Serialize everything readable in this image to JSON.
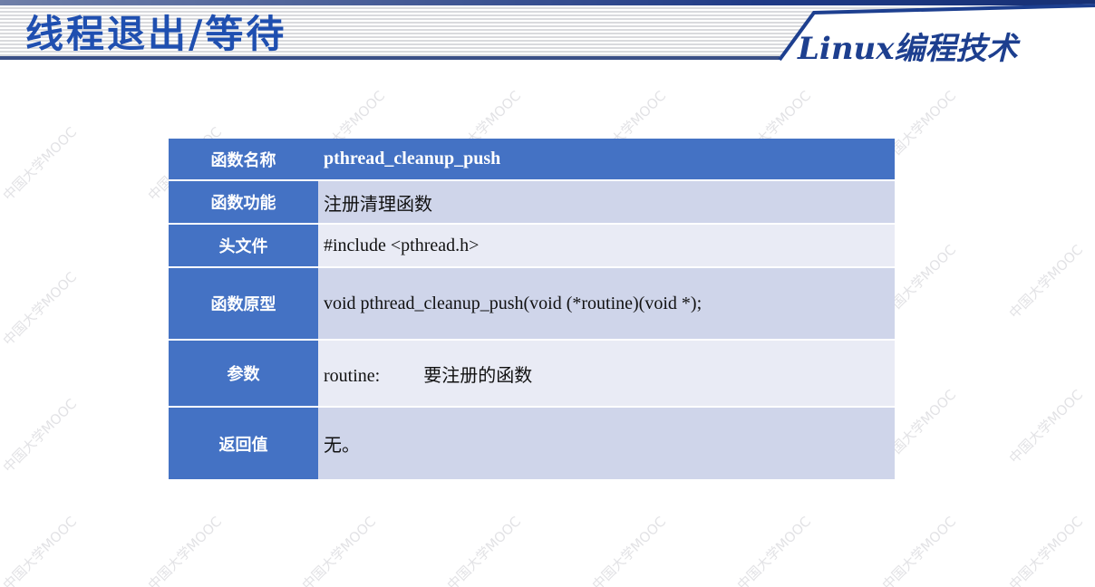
{
  "header": {
    "title": "线程退出/等待",
    "brand": "Linux编程技术"
  },
  "watermark": "中国大学MOOC",
  "table": {
    "rows": [
      {
        "label": "函数名称",
        "value": "pthread_cleanup_push"
      },
      {
        "label": "函数功能",
        "value": "注册清理函数"
      },
      {
        "label": "头文件",
        "value": "#include <pthread.h>"
      },
      {
        "label": "函数原型",
        "value": "void pthread_cleanup_push(void (*routine)(void *);"
      },
      {
        "label": "参数",
        "param_name": "routine:",
        "param_desc": "要注册的函数"
      },
      {
        "label": "返回值",
        "value": "无。"
      }
    ]
  }
}
